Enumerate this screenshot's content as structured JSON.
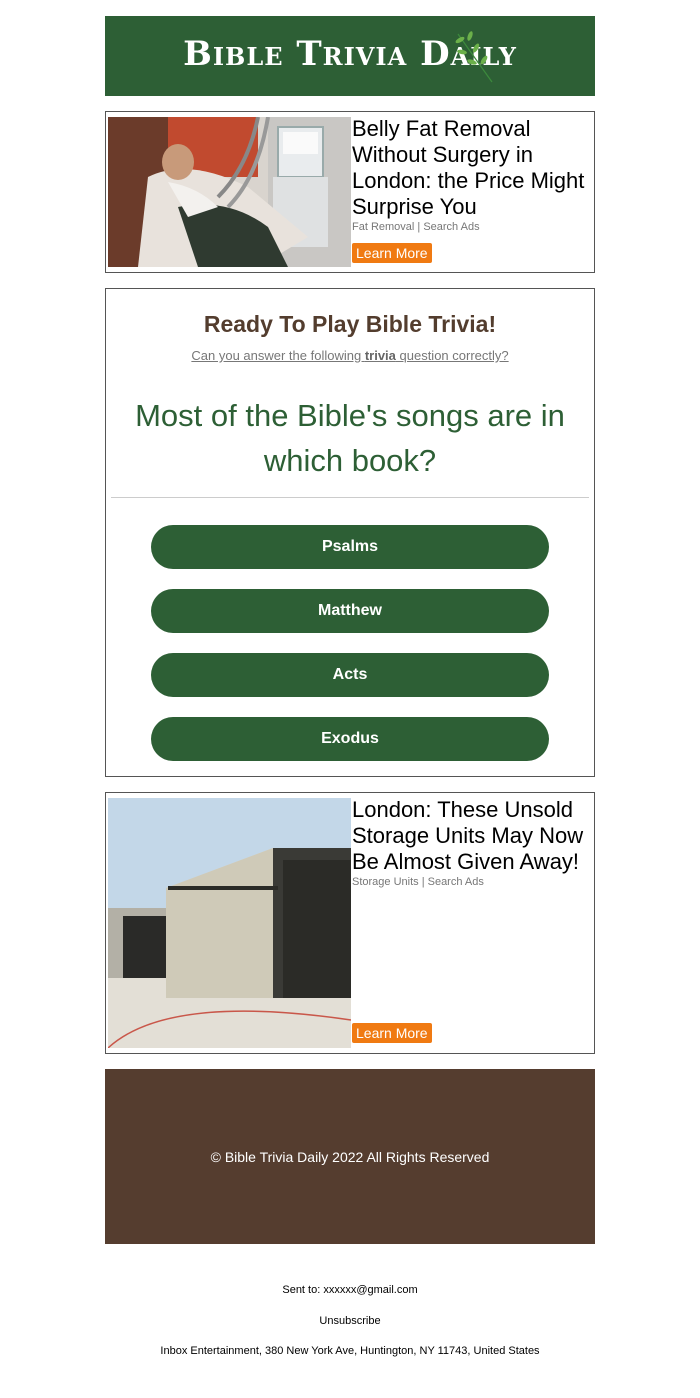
{
  "header": {
    "logo_text": "Bible Trivia Daily",
    "bg_color": "#2d5f35"
  },
  "ad_top": {
    "headline": "Belly Fat Removal Without Surgery in London: the Price Might Surprise You",
    "source": "Fat Removal | Search Ads",
    "cta": "Learn More"
  },
  "quiz": {
    "title": "Ready To Play Bible Trivia!",
    "subtitle_pre": "Can you answer the following ",
    "subtitle_bold": "trivia",
    "subtitle_post": " question correctly?",
    "question": "Most of the Bible's songs are in which book?",
    "answers": [
      "Psalms",
      "Matthew",
      "Acts",
      "Exodus"
    ]
  },
  "ad_bottom": {
    "headline": "London: These Unsold Storage Units May Now Be Almost Given Away!",
    "source": "Storage Units | Search Ads",
    "cta": "Learn More"
  },
  "footer": {
    "copyright": "© Bible Trivia Daily 2022 All Rights Reserved",
    "bg_color": "#553d2f"
  },
  "meta": {
    "sent_to": "Sent to: xxxxxx@gmail.com",
    "unsubscribe": "Unsubscribe",
    "address": "Inbox Entertainment, 380 New York Ave, Huntington, NY 11743, United States"
  },
  "colors": {
    "accent": "#2d5f35",
    "cta": "#f07a12",
    "title_brown": "#533d2e"
  }
}
